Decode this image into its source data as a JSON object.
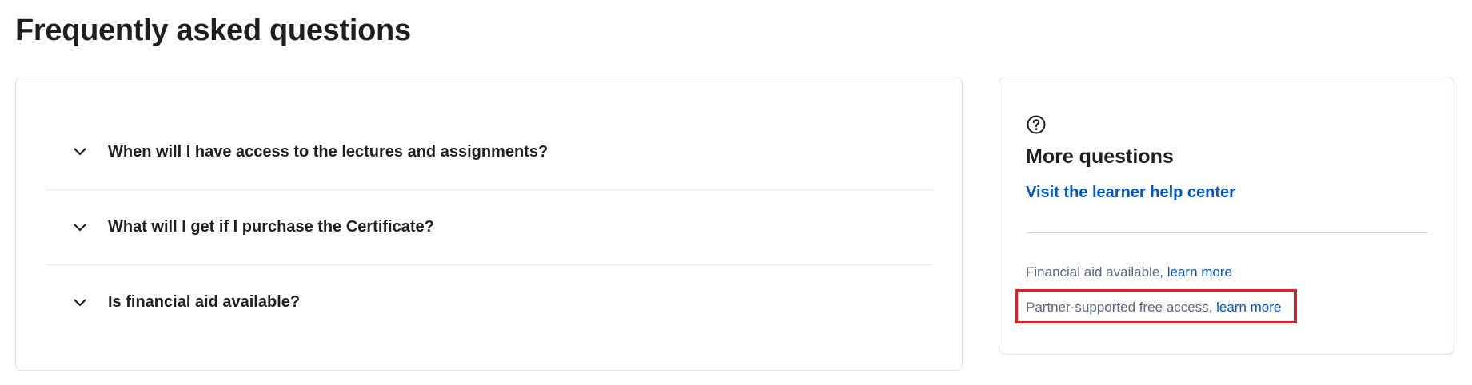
{
  "page": {
    "title": "Frequently asked questions"
  },
  "faq": {
    "items": [
      {
        "question": "When will I have access to the lectures and assignments?",
        "icon": "chevron-down-icon"
      },
      {
        "question": "What will I get if I purchase the Certificate?",
        "icon": "chevron-down-icon"
      },
      {
        "question": "Is financial aid available?",
        "icon": "chevron-down-icon"
      }
    ]
  },
  "sidebar": {
    "icon": "help-circle-icon",
    "title": "More questions",
    "help_link": "Visit the learner help center",
    "financial_aid": {
      "text": "Financial aid available, ",
      "link": "learn more"
    },
    "partner_access": {
      "text": "Partner-supported free access, ",
      "link": "learn more"
    }
  },
  "colors": {
    "link": "#0056d2",
    "highlight": "#e02020",
    "muted_text": "#5b6780",
    "border": "#dbe1ea"
  }
}
